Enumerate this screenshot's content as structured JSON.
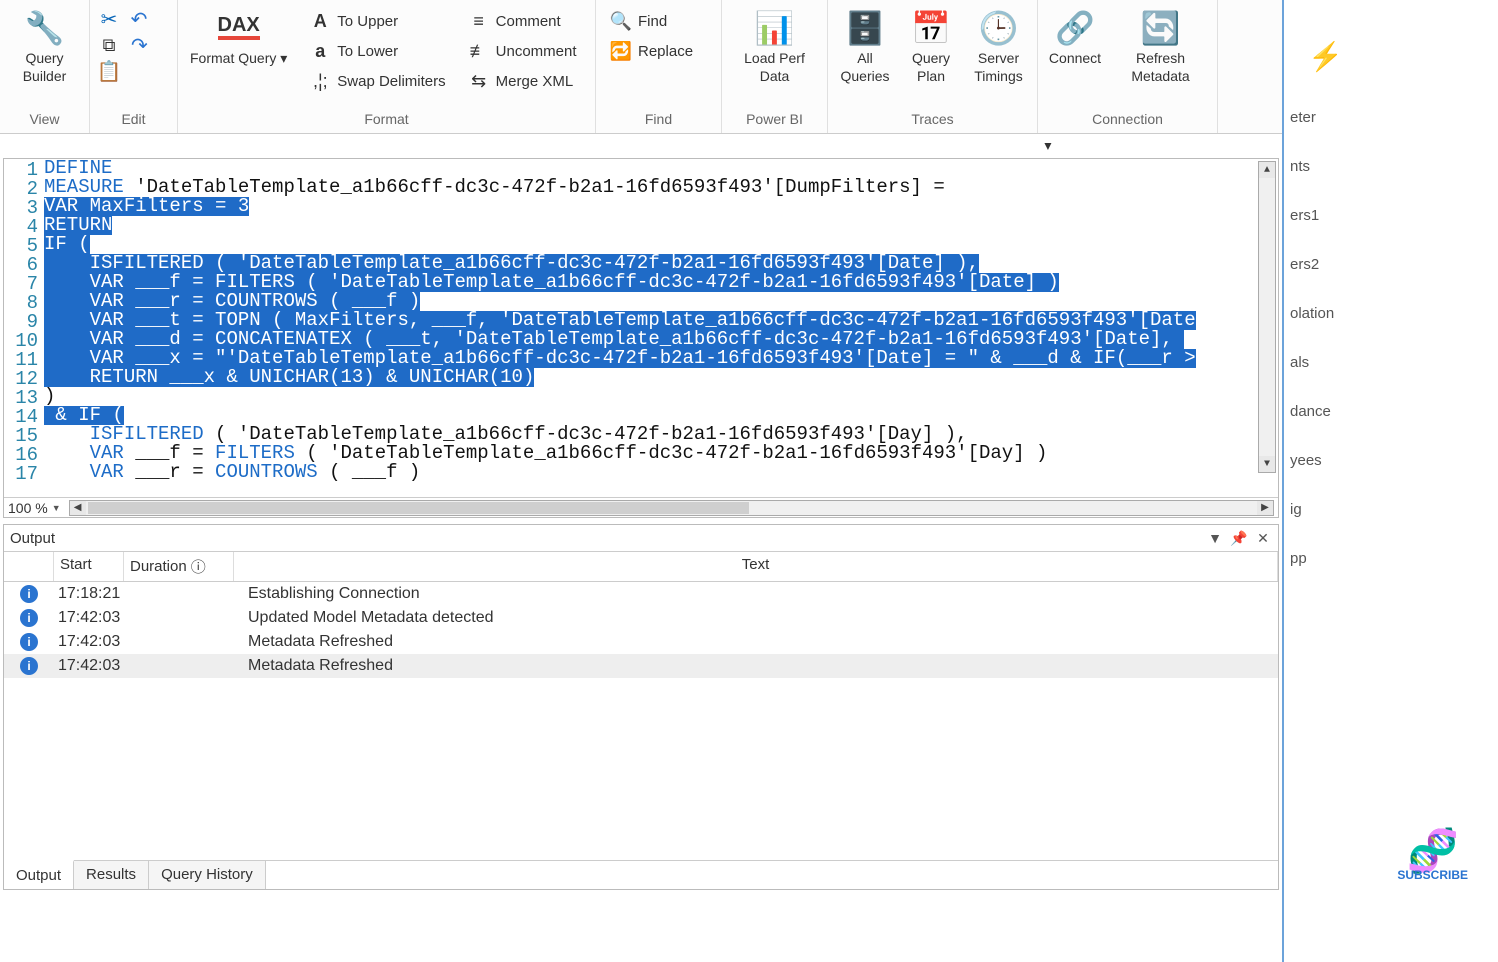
{
  "ribbon": {
    "view": {
      "query_builder": "Query\nBuilder",
      "label": "View"
    },
    "edit": {
      "label": "Edit"
    },
    "format": {
      "format_query": "Format\nQuery ▾",
      "to_upper": "To Upper",
      "to_lower": "To Lower",
      "swap_delimiters": "Swap Delimiters",
      "comment": "Comment",
      "uncomment": "Uncomment",
      "merge_xml": "Merge XML",
      "label": "Format"
    },
    "find": {
      "find": "Find",
      "replace": "Replace",
      "label": "Find"
    },
    "powerbi": {
      "load_perf": "Load Perf\nData",
      "label": "Power BI"
    },
    "traces": {
      "all_queries": "All\nQueries",
      "query_plan": "Query\nPlan",
      "server_timings": "Server\nTimings",
      "label": "Traces"
    },
    "connection": {
      "connect": "Connect",
      "refresh_metadata": "Refresh\nMetadata",
      "label": "Connection"
    }
  },
  "editor": {
    "zoom": "100 %",
    "lines": [
      {
        "n": 1,
        "seg": [
          {
            "t": "DEFINE",
            "cls": "kw"
          }
        ]
      },
      {
        "n": 2,
        "seg": [
          {
            "t": "MEASURE",
            "cls": "kw"
          },
          {
            "t": " 'DateTableTemplate_a1b66cff-dc3c-472f-b2a1-16fd6593f493'[DumpFilters] ="
          }
        ]
      },
      {
        "n": 3,
        "sel": true,
        "seg": [
          {
            "t": "VAR",
            "cls": "kw"
          },
          {
            "t": " MaxFilters = 3"
          }
        ]
      },
      {
        "n": 4,
        "sel": true,
        "seg": [
          {
            "t": "RETURN",
            "cls": "kw"
          }
        ]
      },
      {
        "n": 5,
        "sel": true,
        "seg": [
          {
            "t": "IF",
            "cls": "kw"
          },
          {
            "t": " ("
          }
        ]
      },
      {
        "n": 6,
        "sel": true,
        "seg": [
          {
            "t": "    "
          },
          {
            "t": "ISFILTERED",
            "cls": "kw"
          },
          {
            "t": " ( 'DateTableTemplate_a1b66cff-dc3c-472f-b2a1-16fd6593f493'[Date] ),"
          }
        ]
      },
      {
        "n": 7,
        "sel": true,
        "seg": [
          {
            "t": "    "
          },
          {
            "t": "VAR",
            "cls": "kw"
          },
          {
            "t": " ___f = "
          },
          {
            "t": "FILTERS",
            "cls": "kw"
          },
          {
            "t": " ( 'DateTableTemplate_a1b66cff-dc3c-472f-b2a1-16fd6593f493'[Date] )"
          }
        ]
      },
      {
        "n": 8,
        "sel": true,
        "seg": [
          {
            "t": "    "
          },
          {
            "t": "VAR",
            "cls": "kw"
          },
          {
            "t": " ___r = "
          },
          {
            "t": "COUNTROWS",
            "cls": "kw"
          },
          {
            "t": " ( ___f )"
          }
        ]
      },
      {
        "n": 9,
        "sel": true,
        "seg": [
          {
            "t": "    "
          },
          {
            "t": "VAR",
            "cls": "kw"
          },
          {
            "t": " ___t = "
          },
          {
            "t": "TOPN",
            "cls": "kw"
          },
          {
            "t": " ( MaxFilters, ___f, 'DateTableTemplate_a1b66cff-dc3c-472f-b2a1-16fd6593f493'[Date"
          }
        ]
      },
      {
        "n": 10,
        "sel": true,
        "seg": [
          {
            "t": "    "
          },
          {
            "t": "VAR",
            "cls": "kw"
          },
          {
            "t": " ___d = "
          },
          {
            "t": "CONCATENATEX",
            "cls": "kw"
          },
          {
            "t": " ( ___t, 'DateTableTemplate_a1b66cff-dc3c-472f-b2a1-16fd6593f493'[Date], "
          }
        ]
      },
      {
        "n": 11,
        "sel": true,
        "seg": [
          {
            "t": "    "
          },
          {
            "t": "VAR",
            "cls": "kw"
          },
          {
            "t": " ___x = "
          },
          {
            "t": "\"'DateTableTemplate_a1b66cff-dc3c-472f-b2a1-16fd6593f493'[Date] = \"",
            "cls": "str"
          },
          {
            "t": " & ___d & "
          },
          {
            "t": "IF",
            "cls": "kw"
          },
          {
            "t": "(___r >"
          }
        ]
      },
      {
        "n": 12,
        "sel": true,
        "seg": [
          {
            "t": "    "
          },
          {
            "t": "RETURN",
            "cls": "kw"
          },
          {
            "t": " ___x & "
          },
          {
            "t": "UNICHAR",
            "cls": "kw"
          },
          {
            "t": "(13) & "
          },
          {
            "t": "UNICHAR",
            "cls": "kw"
          },
          {
            "t": "(10)"
          }
        ]
      },
      {
        "n": 13,
        "seg": [
          {
            "t": ")"
          }
        ]
      },
      {
        "n": 14,
        "sel": true,
        "seg": [
          {
            "t": " & "
          },
          {
            "t": "IF",
            "cls": "kw"
          },
          {
            "t": " ("
          }
        ]
      },
      {
        "n": 15,
        "seg": [
          {
            "t": "    "
          },
          {
            "t": "ISFILTERED",
            "cls": "kw"
          },
          {
            "t": " ( 'DateTableTemplate_a1b66cff-dc3c-472f-b2a1-16fd6593f493'[Day] ),"
          }
        ]
      },
      {
        "n": 16,
        "seg": [
          {
            "t": "    "
          },
          {
            "t": "VAR",
            "cls": "kw"
          },
          {
            "t": " ___f = "
          },
          {
            "t": "FILTERS",
            "cls": "kw"
          },
          {
            "t": " ( 'DateTableTemplate_a1b66cff-dc3c-472f-b2a1-16fd6593f493'[Day] )"
          }
        ]
      },
      {
        "n": 17,
        "seg": [
          {
            "t": "    "
          },
          {
            "t": "VAR",
            "cls": "kw"
          },
          {
            "t": " ___r = "
          },
          {
            "t": "COUNTROWS",
            "cls": "kw"
          },
          {
            "t": " ( ___f )"
          }
        ]
      }
    ]
  },
  "output": {
    "title": "Output",
    "cols": {
      "start": "Start",
      "duration": "Duration",
      "text": "Text"
    },
    "rows": [
      {
        "start": "17:18:21",
        "text": "Establishing Connection"
      },
      {
        "start": "17:42:03",
        "text": "Updated Model Metadata detected"
      },
      {
        "start": "17:42:03",
        "text": "Metadata Refreshed"
      },
      {
        "start": "17:42:03",
        "text": "Metadata Refreshed"
      }
    ],
    "tabs": {
      "output": "Output",
      "results": "Results",
      "history": "Query History"
    }
  },
  "right": {
    "items": [
      "eter",
      "nts",
      "ers1",
      "ers2",
      "olation",
      "als",
      "dance",
      "yees",
      "ig",
      "pp"
    ]
  },
  "subscribe": "SUBSCRIBE"
}
